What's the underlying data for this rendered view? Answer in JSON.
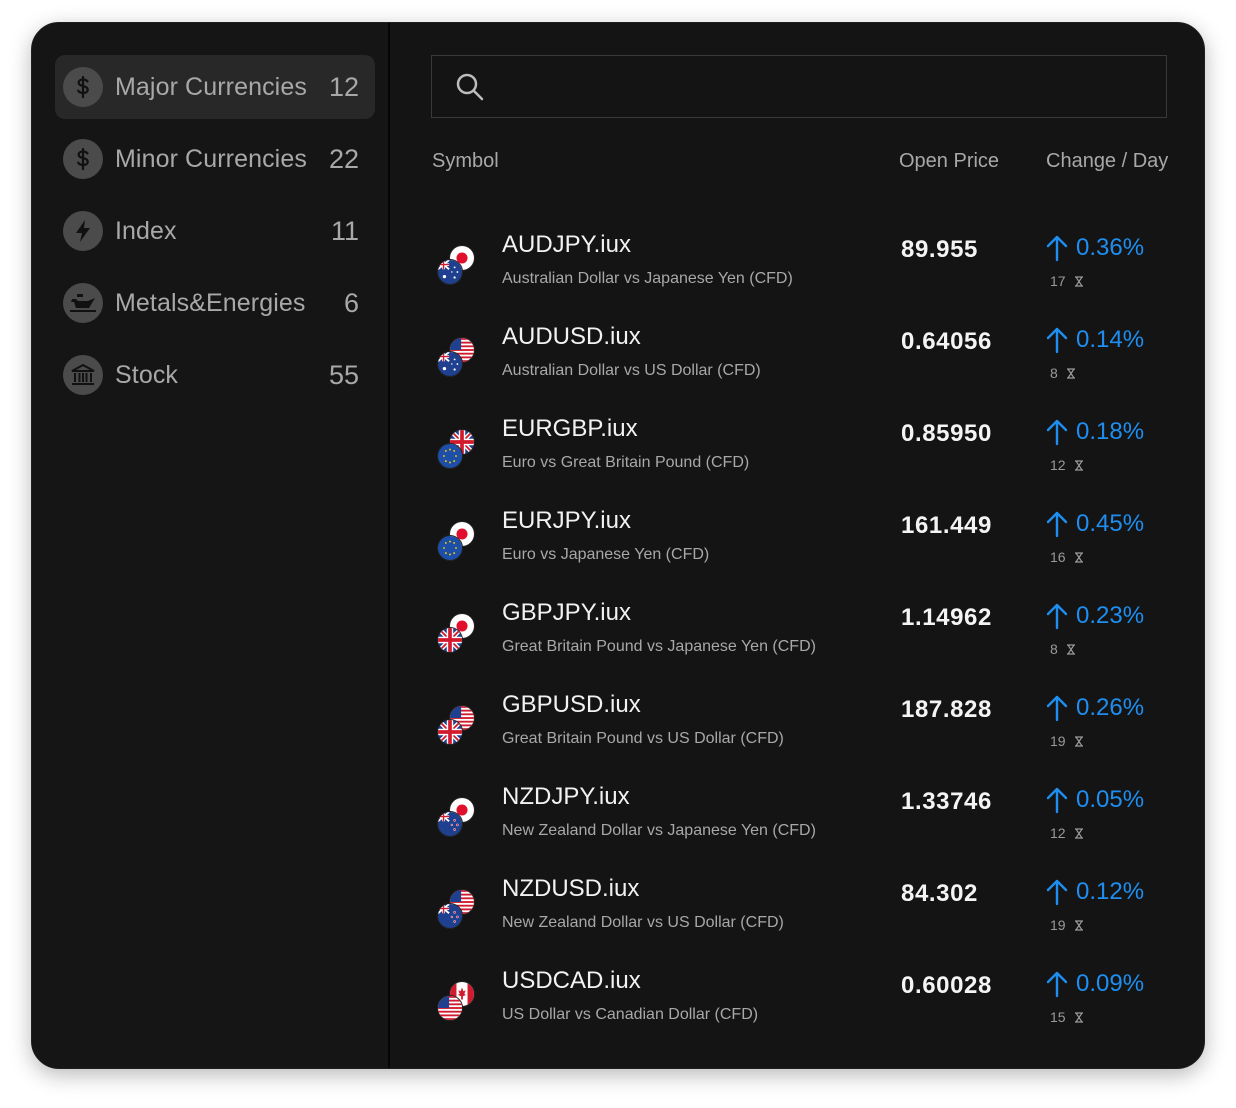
{
  "search": {
    "placeholder": ""
  },
  "categories": [
    {
      "label": "Major Currencies",
      "count": "12",
      "icon": "dollar-icon",
      "active": true
    },
    {
      "label": "Minor Currencies",
      "count": "22",
      "icon": "dollar-icon",
      "active": false
    },
    {
      "label": "Index",
      "count": "11",
      "icon": "lightning-icon",
      "active": false
    },
    {
      "label": "Metals&Energies",
      "count": "6",
      "icon": "oil-can-icon",
      "active": false
    },
    {
      "label": "Stock",
      "count": "55",
      "icon": "bank-icon",
      "active": false
    }
  ],
  "table": {
    "headers": {
      "symbol": "Symbol",
      "open_price": "Open Price",
      "change": "Change / Day"
    },
    "rows": [
      {
        "symbol": "AUDJPY.iux",
        "desc": "Australian Dollar vs Japanese Yen (CFD)",
        "price": "89.955",
        "change": "0.36%",
        "sub": "17",
        "flag_front": "AU",
        "flag_back": "JP"
      },
      {
        "symbol": "AUDUSD.iux",
        "desc": "Australian Dollar vs US Dollar (CFD)",
        "price": "0.64056",
        "change": "0.14%",
        "sub": "8",
        "flag_front": "AU",
        "flag_back": "US"
      },
      {
        "symbol": "EURGBP.iux",
        "desc": "Euro vs Great Britain Pound (CFD)",
        "price": "0.85950",
        "change": "0.18%",
        "sub": "12",
        "flag_front": "EU",
        "flag_back": "GB"
      },
      {
        "symbol": "EURJPY.iux",
        "desc": " Euro vs Japanese Yen (CFD)",
        "price": "161.449",
        "change": "0.45%",
        "sub": "16",
        "flag_front": "EU",
        "flag_back": "JP"
      },
      {
        "symbol": "GBPJPY.iux",
        "desc": "Great Britain Pound vs Japanese Yen (CFD)",
        "price": "1.14962",
        "change": "0.23%",
        "sub": "8",
        "flag_front": "GB",
        "flag_back": "JP"
      },
      {
        "symbol": "GBPUSD.iux",
        "desc": "Great Britain Pound vs US Dollar (CFD)",
        "price": "187.828",
        "change": "0.26%",
        "sub": "19",
        "flag_front": "GB",
        "flag_back": "US"
      },
      {
        "symbol": "NZDJPY.iux",
        "desc": "New Zealand Dollar vs Japanese Yen (CFD)",
        "price": "1.33746",
        "change": "0.05%",
        "sub": "12",
        "flag_front": "NZ",
        "flag_back": "JP"
      },
      {
        "symbol": "NZDUSD.iux",
        "desc": "New Zealand Dollar vs US Dollar (CFD)",
        "price": "84.302",
        "change": "0.12%",
        "sub": "19",
        "flag_front": "NZ",
        "flag_back": "US"
      },
      {
        "symbol": "USDCAD.iux",
        "desc": "US Dollar vs Canadian Dollar (CFD)",
        "price": "0.60028",
        "change": "0.09%",
        "sub": "15",
        "flag_front": "US",
        "flag_back": "CA"
      }
    ]
  },
  "colors": {
    "accent": "#1e8ef0",
    "card_bg": "#141414",
    "active_item": "#282828"
  }
}
